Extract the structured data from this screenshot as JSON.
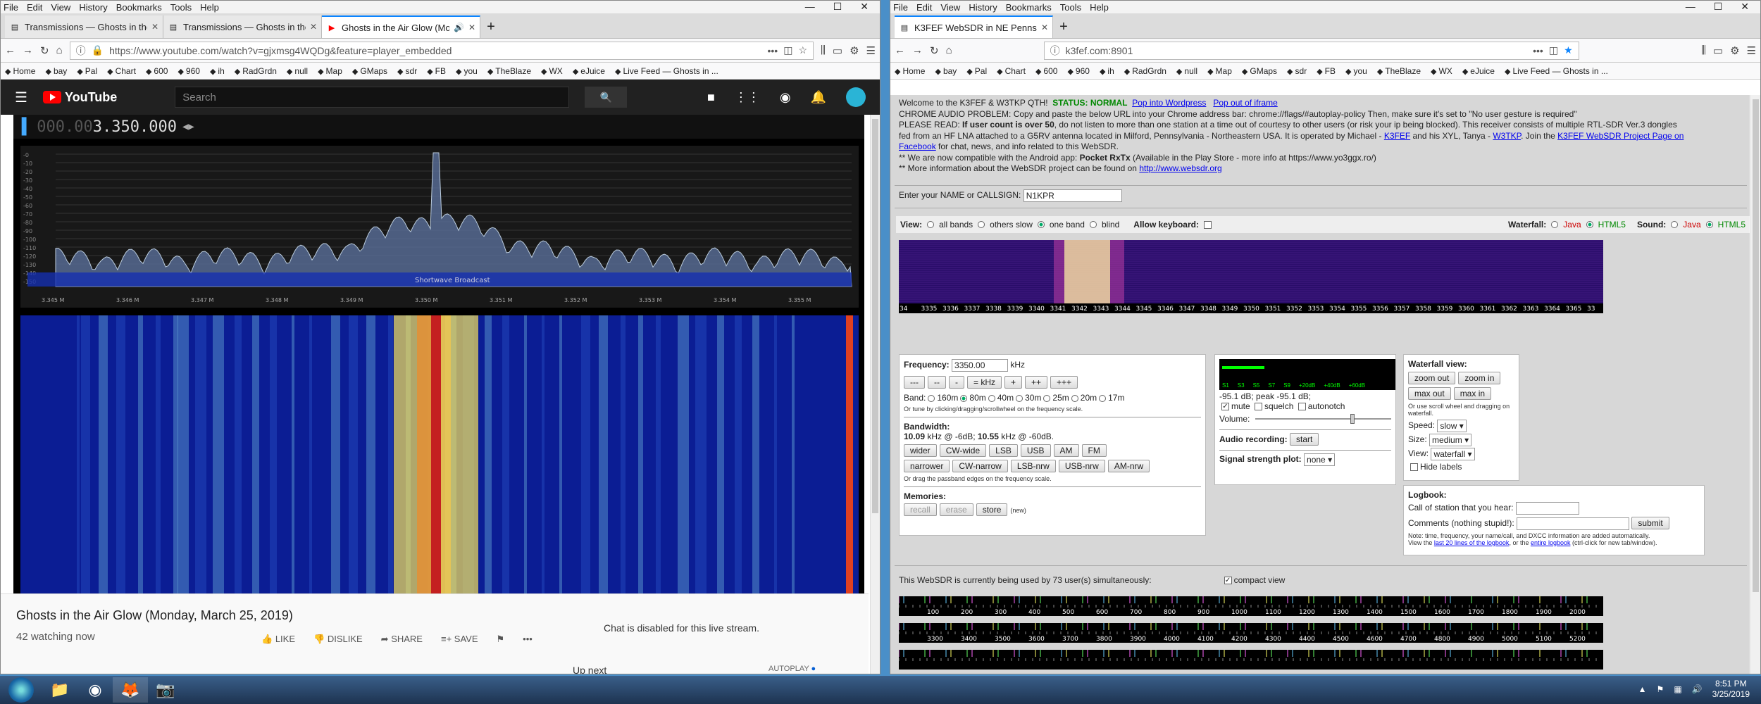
{
  "menu": [
    "File",
    "Edit",
    "View",
    "History",
    "Bookmarks",
    "Tools",
    "Help"
  ],
  "left": {
    "tabs": [
      "Transmissions — Ghosts in the Ai...",
      "Transmissions — Ghosts in the Ai...",
      "Ghosts in the Air Glow (Mo..."
    ],
    "url": "https://www.youtube.com/watch?v=gjxmsg4WQDg&feature=player_embedded",
    "yt_logo": "YouTube",
    "search_placeholder": "Search",
    "freq_dim": "000.00",
    "freq_lit": "3.350.000",
    "spectrum_label": "Shortwave Broadcast",
    "freq_ticks": [
      "3.345 M",
      "3.346 M",
      "3.347 M",
      "3.348 M",
      "3.349 M",
      "3.350 M",
      "3.351 M",
      "3.352 M",
      "3.353 M",
      "3.354 M",
      "3.355 M"
    ],
    "db_ticks": [
      "-0",
      "-10",
      "-20",
      "-30",
      "-40",
      "-50",
      "-60",
      "-70",
      "-80",
      "-90",
      "-100",
      "-110",
      "-120",
      "-130",
      "-140",
      "-150"
    ],
    "video_title": "Ghosts in the Air Glow (Monday, March 25, 2019)",
    "watching": "42 watching now",
    "actions": {
      "like": "LIKE",
      "dislike": "DISLIKE",
      "share": "SHARE",
      "save": "SAVE"
    },
    "chat_disabled": "Chat is disabled for this live stream.",
    "up_next": "Up next",
    "autoplay": "AUTOPLAY"
  },
  "bookmarks": [
    "Home",
    "bay",
    "Pal",
    "Chart",
    "600",
    "960",
    "ih",
    "RadGrdn",
    "null",
    "Map",
    "GMaps",
    "sdr",
    "FB",
    "you",
    "TheBlaze",
    "WX",
    "eJuice",
    "Live Feed — Ghosts in ..."
  ],
  "right": {
    "tab": "K3FEF WebSDR in NE Pennsylv...",
    "url": "k3fef.com:8901",
    "welcome": "Welcome to the K3FEF & W3TKP QTH!",
    "status": "STATUS: NORMAL",
    "pop_wp": "Pop into Wordpress",
    "pop_iframe": "Pop out of iframe",
    "line2": "CHROME AUDIO PROBLEM: Copy and paste the below URL into your Chrome address bar: chrome://flags/#autoplay-policy Then, make sure it's set to \"No user gesture is required\"",
    "line3a": "PLEASE READ:",
    "line3b": "If user count is over 50",
    "line3c": ", do not listen to more than one station at a time out of courtesy to other users (or risk your ip being blocked). This receiver consists of multiple RTL-SDR Ver.3 dongles",
    "line4a": "fed from an HF LNA attached to a G5RV antenna located in Milford, Pennsylvania - Northeastern USA. It is operated by Michael - ",
    "k3fef": "K3FEF",
    "and_xyl": " and his XYL, Tanya - ",
    "w3tkp": "W3TKP",
    "join": ". Join the ",
    "fbpage": "K3FEF WebSDR Project Page on",
    "line5a": "Facebook",
    "line5b": " for chat, news, and info related to this WebSDR.",
    "line6a": "** We are now compatible with the Android app: ",
    "line6b": "Pocket RxTx",
    "line6c": " (Available in the Play Store - more info at https://www.yo3ggx.ro/)",
    "line7a": "** More information about the WebSDR project can be found on ",
    "line7b": "http://www.websdr.org",
    "name_label": "Enter your NAME or CALLSIGN:",
    "name_value": "N1KPR",
    "view_label": "View:",
    "view_opts": [
      "all bands",
      "others slow",
      "one band",
      "blind"
    ],
    "allow_kb": "Allow keyboard:",
    "waterfall_label": "Waterfall:",
    "sound_label": "Sound:",
    "java": "Java",
    "html5": "HTML5",
    "wf_ticks": [
      "34",
      "3335",
      "3336",
      "3337",
      "3338",
      "3339",
      "3340",
      "3341",
      "3342",
      "3343",
      "3344",
      "3345",
      "3346",
      "3347",
      "3348",
      "3349",
      "3350",
      "3351",
      "3352",
      "3353",
      "3354",
      "3355",
      "3356",
      "3357",
      "3358",
      "3359",
      "3360",
      "3361",
      "3362",
      "3363",
      "3364",
      "3365",
      "33"
    ],
    "freq_label": "Frequency:",
    "freq_value": "3350.00",
    "khz": "kHz",
    "step_btns": [
      "---",
      "--",
      "-",
      "= kHz",
      "+",
      "++",
      "+++"
    ],
    "band_label": "Band:",
    "bands": [
      "160m",
      "80m",
      "40m",
      "30m",
      "25m",
      "20m",
      "17m"
    ],
    "tune_hint": "Or tune by clicking/dragging/scrollwheel on the frequency scale.",
    "bw_label": "Bandwidth:",
    "bw_a": "10.09",
    "bw_b": " kHz @ -6dB; ",
    "bw_c": "10.55",
    "bw_d": " kHz @ -60dB.",
    "modes1": [
      "wider",
      "CW-wide",
      "LSB",
      "USB",
      "AM",
      "FM"
    ],
    "modes2": [
      "narrower",
      "CW-narrow",
      "LSB-nrw",
      "USB-nrw",
      "AM-nrw"
    ],
    "drag_hint": "Or drag the passband edges on the frequency scale.",
    "memories": "Memories:",
    "mem_btns": [
      "recall",
      "erase",
      "store"
    ],
    "mem_new": "(new)",
    "meter_ticks": [
      "S1",
      "S3",
      "S5",
      "S7",
      "S9",
      "+20dB",
      "+40dB",
      "+60dB"
    ],
    "db_readout": "-95.1 dB; peak  -95.1 dB;",
    "mute": "mute",
    "squelch": "squelch",
    "autonotch": "autonotch",
    "volume": "Volume:",
    "audio_rec": "Audio recording:",
    "start": "start",
    "sig_plot": "Signal strength plot:",
    "sig_plot_val": "none",
    "wfview": "Waterfall view:",
    "zoom_out": "zoom out",
    "zoom_in": "zoom in",
    "max_out": "max out",
    "max_in": "max in",
    "scroll_hint": "Or use scroll wheel and dragging on waterfall.",
    "speed": "Speed:",
    "speed_v": "slow",
    "size": "Size:",
    "size_v": "medium",
    "view2": "View:",
    "view2_v": "waterfall",
    "hide_labels": "Hide labels",
    "logbook": "Logbook:",
    "call_label": "Call of station that you hear:",
    "comments_label": "Comments (nothing stupid!):",
    "submit": "submit",
    "log_note": "Note: time, frequency, your name/call, and DXCC information are added automatically.",
    "log_view_a": "View the ",
    "log_view_b": "last 20 lines of the logbook",
    "log_view_c": ", or the ",
    "log_view_d": "entire logbook",
    "log_view_e": " (ctrl-click for new tab/window).",
    "users": "This WebSDR is currently being used by 73 user(s) simultaneously:",
    "compact": "compact view",
    "scale1": [
      "100",
      "200",
      "300",
      "400",
      "500",
      "600",
      "700",
      "800",
      "900",
      "1000",
      "1100",
      "1200",
      "1300",
      "1400",
      "1500",
      "1600",
      "1700",
      "1800",
      "1900",
      "2000"
    ],
    "scale2": [
      "3300",
      "3400",
      "3500",
      "3600",
      "3700",
      "3800",
      "3900",
      "4000",
      "4100",
      "4200",
      "4300",
      "4400",
      "4500",
      "4600",
      "4700",
      "4800",
      "4900",
      "5000",
      "5100",
      "5200"
    ]
  },
  "clock": {
    "time": "8:51 PM",
    "date": "3/25/2019"
  }
}
